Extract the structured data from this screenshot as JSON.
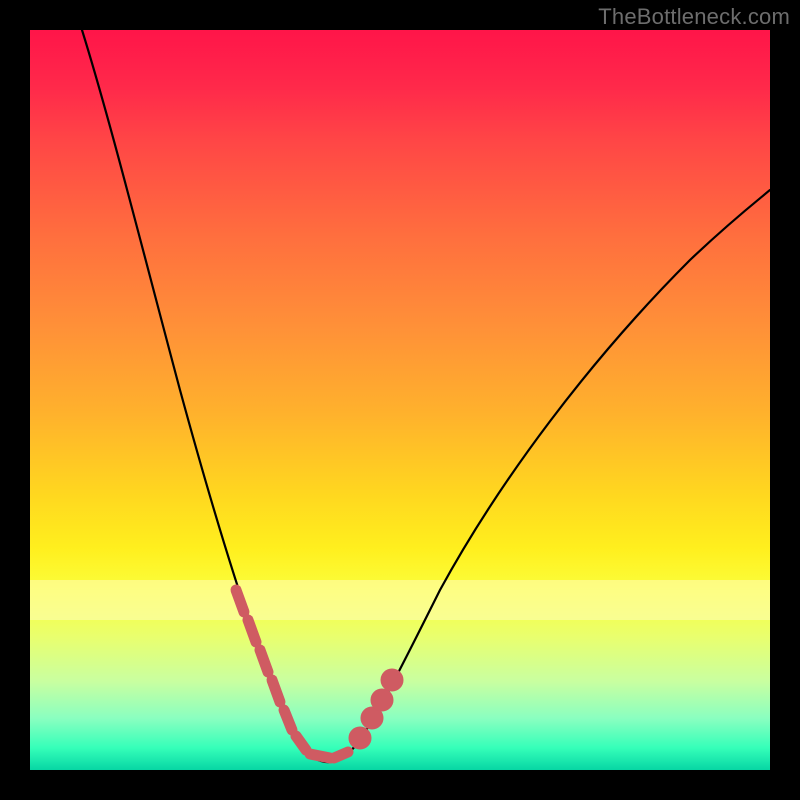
{
  "watermark": {
    "text": "TheBottleneck.com"
  },
  "colors": {
    "background": "#000000",
    "curve": "#000000",
    "marker": "#cf5b62",
    "gradient_top": "#ff1549",
    "gradient_bottom": "#07d6a4",
    "pale_band": "#fffec0"
  },
  "chart_data": {
    "type": "line",
    "title": "",
    "xlabel": "",
    "ylabel": "",
    "xlim": [
      0,
      100
    ],
    "ylim": [
      0,
      100
    ],
    "note": "No axis tick labels are visible; values below are estimated from geometry (x=0 at left edge of colored area, y=0 at bottom).",
    "series": [
      {
        "name": "bottleneck-curve",
        "x": [
          7,
          10,
          14,
          18,
          22,
          26,
          30,
          32,
          34,
          36,
          38,
          40,
          42,
          44,
          48,
          54,
          60,
          68,
          78,
          90,
          100
        ],
        "y": [
          100,
          88,
          74,
          60,
          46,
          32,
          17,
          10,
          5,
          2,
          1,
          1,
          2,
          5,
          12,
          22,
          32,
          42,
          54,
          66,
          76
        ]
      }
    ],
    "markers": {
      "name": "highlight-points",
      "color": "#cf5b62",
      "x": [
        27,
        29,
        31,
        33,
        35,
        37,
        39,
        41,
        43,
        45,
        46,
        48
      ],
      "y": [
        26,
        19,
        13,
        8,
        4,
        2,
        1,
        2,
        4,
        8,
        11,
        15
      ]
    }
  }
}
